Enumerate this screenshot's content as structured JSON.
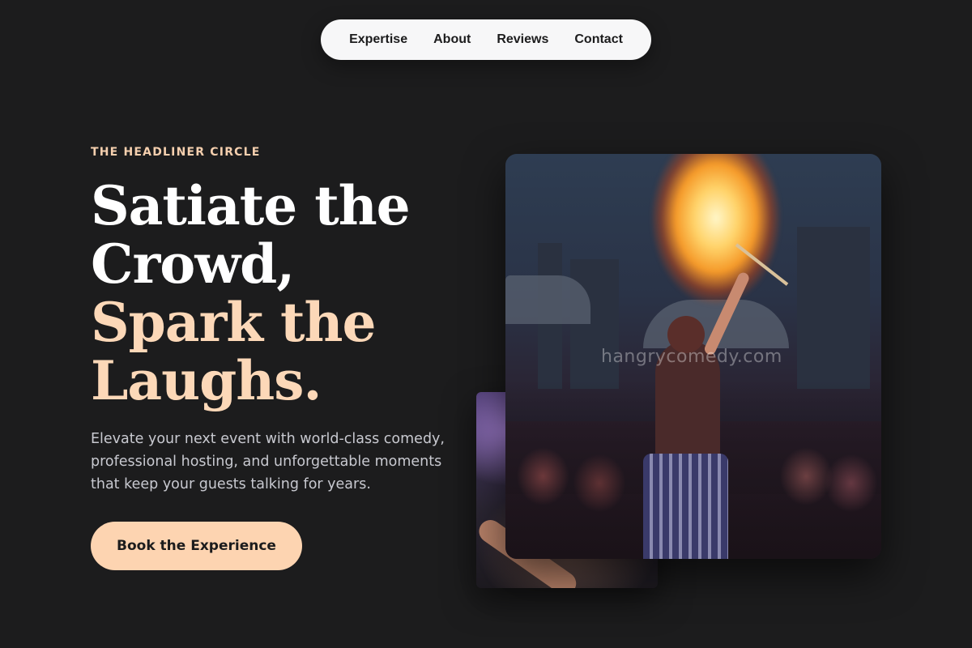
{
  "nav": {
    "items": [
      {
        "label": "Expertise"
      },
      {
        "label": "About"
      },
      {
        "label": "Reviews"
      },
      {
        "label": "Contact"
      }
    ]
  },
  "hero": {
    "eyebrow": "THE HEADLINER CIRCLE",
    "headline_line1": "Satiate the",
    "headline_line2": "Crowd,",
    "headline_line3": "Spark the",
    "headline_line4": "Laughs.",
    "description": "Elevate your next event with world-class comedy, professional hosting, and unforgettable moments that keep your guests talking for years.",
    "cta_label": "Book the Experience"
  },
  "images": {
    "main_watermark": "hangrycomedy.com"
  },
  "colors": {
    "background": "#1c1c1d",
    "accent": "#fdd4b1",
    "nav_bg": "#f7f7f8"
  }
}
